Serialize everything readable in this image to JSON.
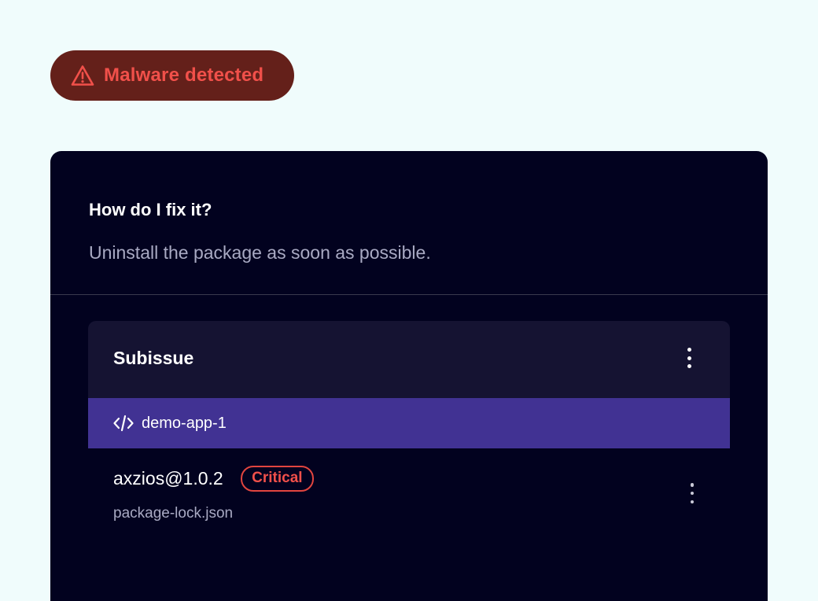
{
  "alert": {
    "label": "Malware detected",
    "icon": "warning-triangle-icon",
    "color": "#f1504a",
    "background": "#64201a"
  },
  "fix": {
    "title": "How do I fix it?",
    "description": "Uninstall the package as soon as possible."
  },
  "subissue": {
    "title": "Subissue",
    "menu_icon": "kebab-menu-icon",
    "repo": {
      "icon": "code-icon",
      "name": "demo-app-1"
    },
    "items": [
      {
        "package": "axzios@1.0.2",
        "severity": "Critical",
        "file": "package-lock.json",
        "menu_icon": "kebab-menu-icon"
      }
    ]
  },
  "colors": {
    "panel": "#02021f",
    "card_header": "#151332",
    "repo_bar": "#413293",
    "critical": "#e2453f"
  }
}
